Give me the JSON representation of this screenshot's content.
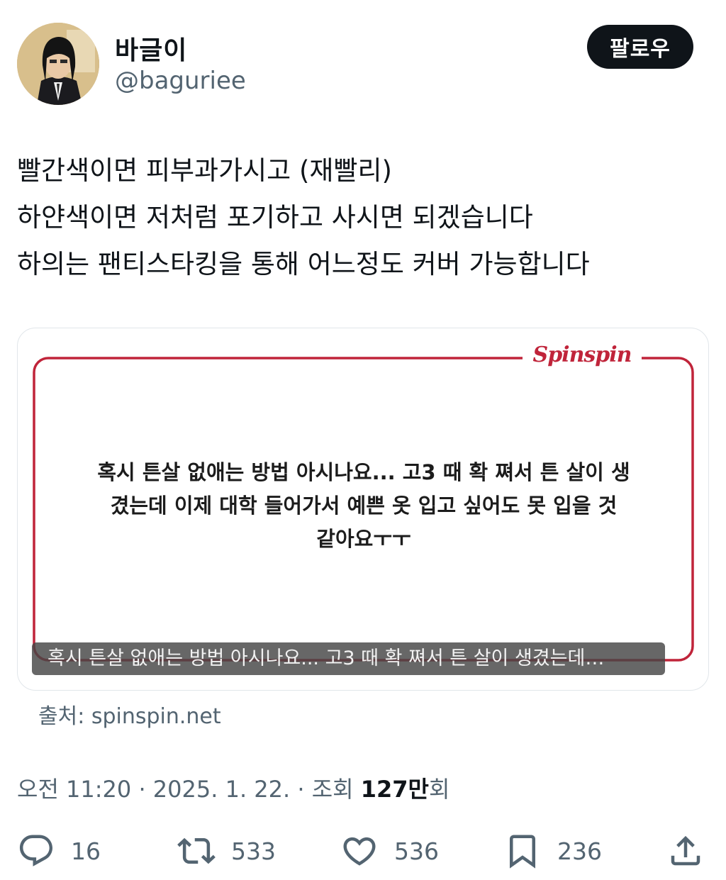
{
  "author": {
    "display_name": "바글이",
    "handle": "@baguriee"
  },
  "follow_button": {
    "label": "팔로우"
  },
  "post": {
    "lines": [
      "빨간색이면 피부과가시고 (재빨리)",
      "하얀색이면 저처럼 포기하고 사시면 되겠습니다",
      "하의는 팬티스타킹을 통해 어느정도 커버 가능합니다"
    ]
  },
  "card": {
    "brand": "Spinspin",
    "question_lines": [
      "혹시 튼살 없애는 방법 아시나요... 고3 때 확 쪄서 튼 살이 생",
      "겼는데 이제 대학 들어가서 예쁜 옷 입고 싶어도 못 입을 것",
      "같아요ㅜㅜ"
    ],
    "caption": "혹시 튼살 없애는 방법 아시나요... 고3 때 확 쪄서 튼 살이 생겼는데…",
    "frame_color": "#c0243a"
  },
  "source": "출처: spinspin.net",
  "meta": {
    "time": "오전 11:20",
    "separator": " · ",
    "date": "2025. 1. 22.",
    "views_label": "조회 ",
    "views_count": "127만",
    "views_suffix": "회"
  },
  "actions": {
    "reply": {
      "icon": "reply-icon",
      "count": "16"
    },
    "retweet": {
      "icon": "retweet-icon",
      "count": "533"
    },
    "like": {
      "icon": "heart-icon",
      "count": "536"
    },
    "bookmark": {
      "icon": "bookmark-icon",
      "count": "236"
    },
    "share": {
      "icon": "share-icon"
    }
  },
  "colors": {
    "text": "#0f1419",
    "secondary": "#536471",
    "button_bg": "#0f1419",
    "accent_red": "#c0243a"
  }
}
